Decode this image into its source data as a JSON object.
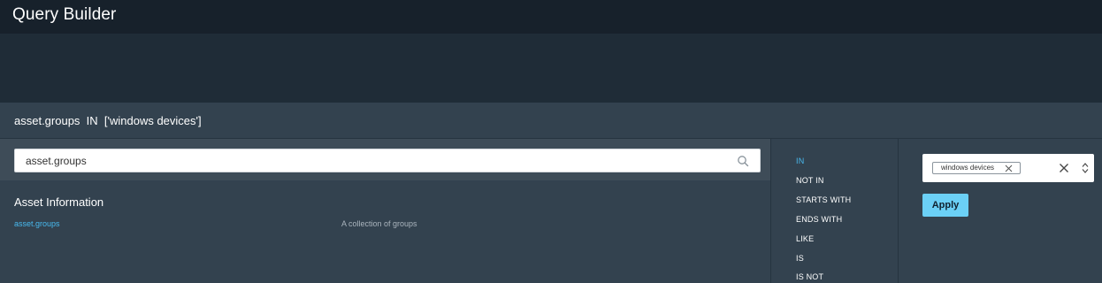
{
  "app": {
    "title": "Query Builder"
  },
  "query": {
    "text": "asset.groups  IN  ['windows devices']"
  },
  "search": {
    "value": "asset.groups",
    "icon": "search-icon"
  },
  "fields": {
    "section_title": "Asset Information",
    "items": [
      {
        "name": "asset.groups",
        "description": "A collection of groups"
      }
    ]
  },
  "operators": {
    "selected": "IN",
    "items": [
      "IN",
      "NOT IN",
      "STARTS WITH",
      "ENDS WITH",
      "LIKE",
      "IS",
      "IS NOT"
    ]
  },
  "value": {
    "tags": [
      "windows devices"
    ],
    "apply_label": "Apply"
  },
  "colors": {
    "accent": "#48b9ee",
    "apply_button": "#6bd0f6",
    "titlebar": "#17212b",
    "panel": "#33424f"
  }
}
